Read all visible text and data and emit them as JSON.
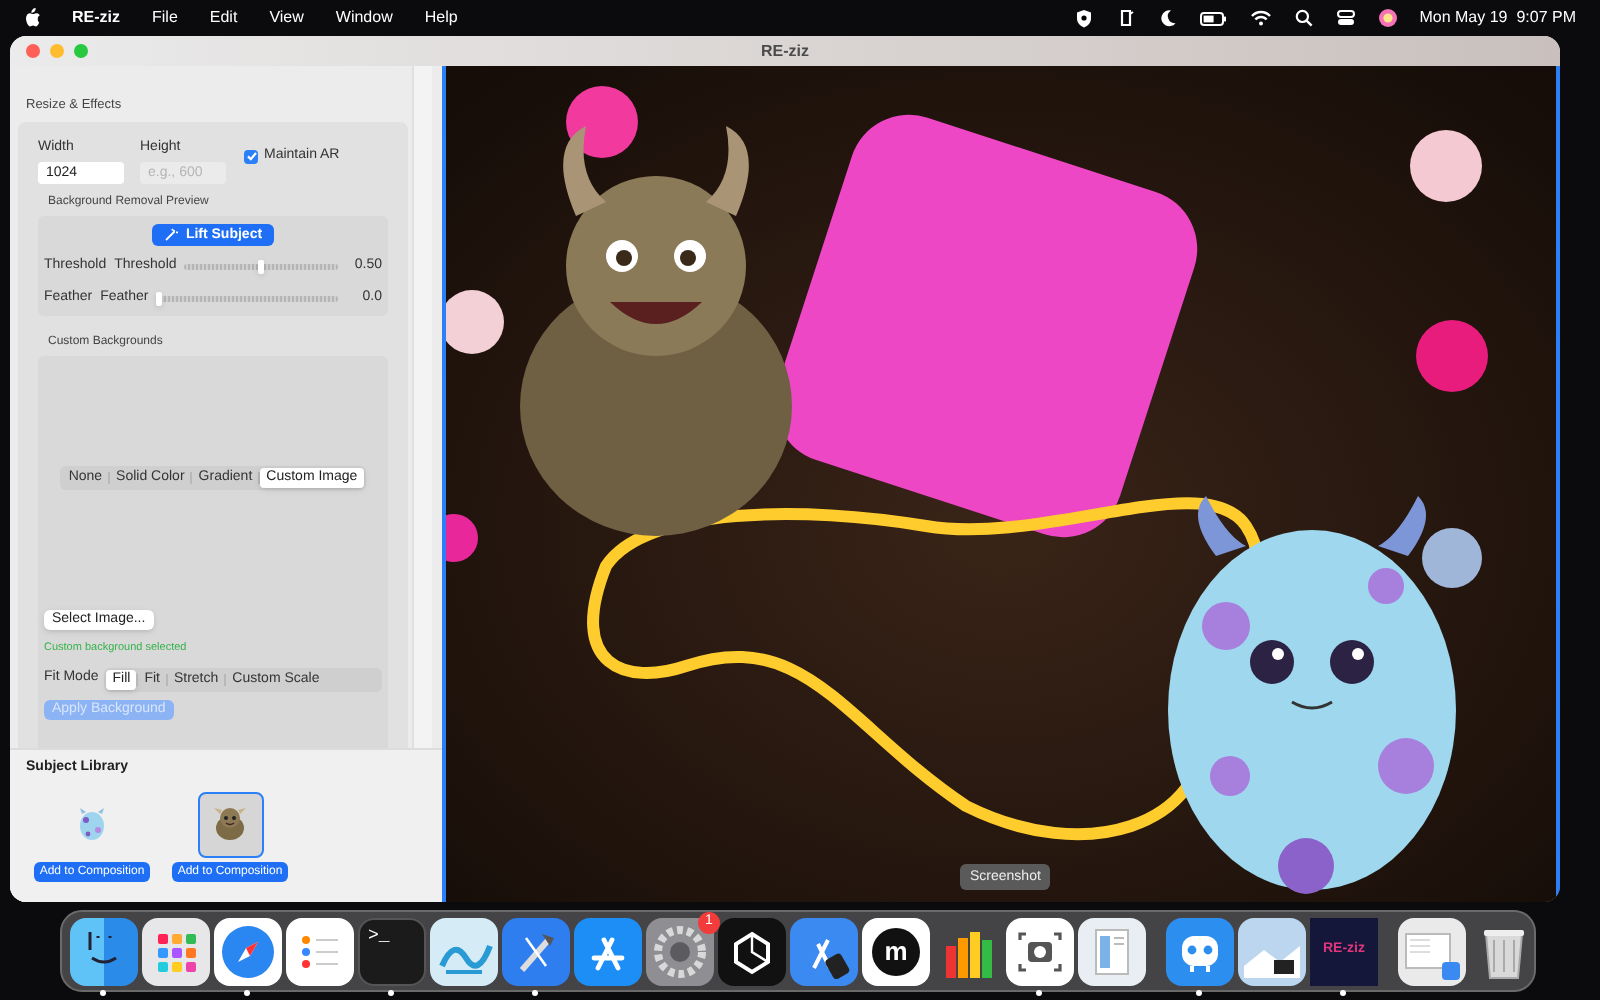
{
  "menu_bar": {
    "app_name": "RE-ziz",
    "menus": [
      "File",
      "Edit",
      "View",
      "Window",
      "Help"
    ],
    "clock": "Mon May 19  9:07 PM"
  },
  "window": {
    "title": "RE-ziz"
  },
  "sidebar": {
    "section_title": "Resize & Effects",
    "width": {
      "label": "Width",
      "value": "1024"
    },
    "height": {
      "label": "Height",
      "placeholder": "e.g., 600"
    },
    "maintain_ar": {
      "label": "Maintain AR",
      "checked": true
    },
    "removal_preview": {
      "title": "Background Removal Preview",
      "button": "Lift Subject",
      "sliders": [
        {
          "label": "Threshold",
          "sublabel": "Threshold",
          "level": 0.5,
          "reading": "0.50"
        },
        {
          "label": "Feather",
          "sublabel": "Feather",
          "level": 0.0,
          "reading": "0.0"
        }
      ]
    },
    "custom_backgrounds": {
      "title": "Custom Backgrounds",
      "segments": [
        {
          "label": "None",
          "selected": false
        },
        {
          "label": "Solid Color",
          "selected": false
        },
        {
          "label": "Gradient",
          "selected": false
        },
        {
          "label": "Custom Image",
          "selected": true
        }
      ],
      "select_button": "Select Image...",
      "status": "Custom background selected",
      "fit_mode": {
        "label": "Fit Mode",
        "options": [
          {
            "label": "Fill",
            "selected": true
          },
          {
            "label": "Fit",
            "selected": false
          },
          {
            "label": "Stretch",
            "selected": false
          },
          {
            "label": "Custom Scale",
            "selected": false
          }
        ]
      },
      "apply_button": {
        "label": "Apply Background",
        "disabled": true
      }
    }
  },
  "subject_library": {
    "title": "Subject Library",
    "items": [
      {
        "kind": "spotted",
        "button": "Add to Composition",
        "selected": false
      },
      {
        "kind": "furry",
        "button": "Add to Composition",
        "selected": true
      }
    ]
  },
  "dock": {
    "tooltip": "Screenshot",
    "items": [
      {
        "kind": "finder",
        "running": true
      },
      {
        "kind": "launchpad",
        "running": false
      },
      {
        "kind": "safari",
        "running": true
      },
      {
        "kind": "reminders",
        "running": false
      },
      {
        "kind": "terminal",
        "text": ">_",
        "running": true
      },
      {
        "kind": "wave",
        "running": false
      },
      {
        "kind": "xcode",
        "running": true
      },
      {
        "kind": "appstore",
        "running": false
      },
      {
        "kind": "settings",
        "badge": "1",
        "running": false
      },
      {
        "kind": "cursor",
        "running": false
      },
      {
        "kind": "simulator",
        "running": false
      },
      {
        "kind": "letter",
        "text": "m",
        "running": false
      },
      {
        "kind": "bars",
        "running": false
      },
      {
        "kind": "screenshot",
        "running": true
      },
      {
        "kind": "document",
        "running": false
      },
      {
        "kind": "separator"
      },
      {
        "kind": "robot",
        "running": true
      },
      {
        "kind": "photo",
        "running": false
      },
      {
        "kind": "brand",
        "text": "RE-ziz",
        "running": true
      },
      {
        "kind": "separator"
      },
      {
        "kind": "folder",
        "running": false
      },
      {
        "kind": "trash",
        "running": false
      }
    ]
  }
}
